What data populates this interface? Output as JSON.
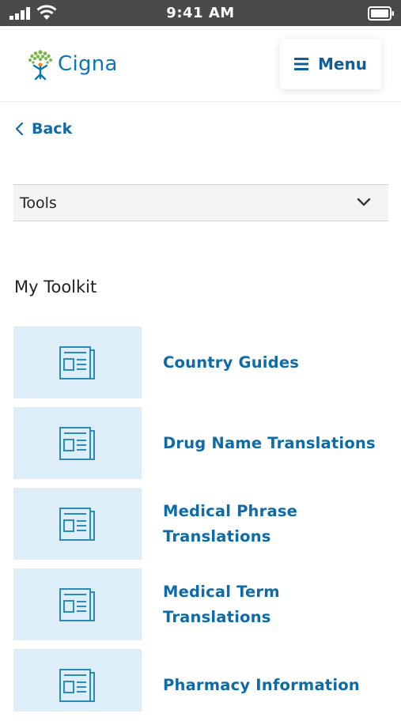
{
  "status_bar": {
    "time": "9:41 AM"
  },
  "header": {
    "logo_text": "Cigna",
    "menu_label": "Menu"
  },
  "nav": {
    "back_label": "Back"
  },
  "tools_select": {
    "value": "Tools"
  },
  "toolkit": {
    "title": "My Toolkit",
    "items": [
      {
        "label": "Country Guides"
      },
      {
        "label": "Drug Name Translations"
      },
      {
        "label": "Medical Phrase Translations"
      },
      {
        "label": "Medical Term Translations"
      },
      {
        "label": "Pharmacy Information"
      }
    ]
  },
  "colors": {
    "brand_blue": "#0f6aa8",
    "tile_background": "#ddeef8",
    "status_bar": "#4a4a4a",
    "logo_green": "#7ab648"
  }
}
